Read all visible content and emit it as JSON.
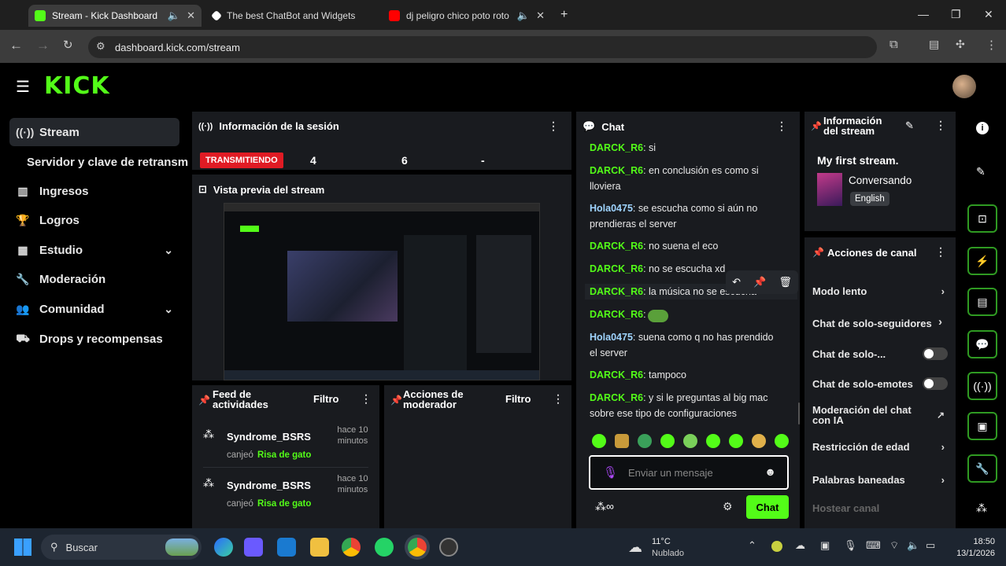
{
  "browser": {
    "tabs": [
      {
        "title": "Stream - Kick Dashboard",
        "active": true
      },
      {
        "title": "The best ChatBot and Widgets"
      },
      {
        "title": "dj peligro chico poto roto -"
      }
    ],
    "url": "dashboard.kick.com/stream"
  },
  "brand": {
    "logo": "KICK",
    "accent": "#53fc18"
  },
  "sidebar": {
    "items": [
      {
        "label": "Stream",
        "icon": "broadcast-icon"
      },
      {
        "label": "Servidor y clave de retransm"
      },
      {
        "label": "Ingresos",
        "icon": "chart-icon"
      },
      {
        "label": "Logros",
        "icon": "trophy-icon"
      },
      {
        "label": "Estudio",
        "icon": "studio-icon"
      },
      {
        "label": "Moderación",
        "icon": "wrench-icon"
      },
      {
        "label": "Comunidad",
        "icon": "users-icon"
      },
      {
        "label": "Drops y recompensas",
        "icon": "gift-icon"
      }
    ]
  },
  "session": {
    "title": "Información de la sesión",
    "status": "TRANSMITIENDO",
    "stats": [
      "4",
      "6",
      "-"
    ]
  },
  "preview": {
    "title": "Vista previa del stream"
  },
  "feed": {
    "title": "Feed de actividades",
    "filter": "Filtro",
    "items": [
      {
        "user": "Syndrome_BSRS",
        "time": "hace 10 minutos",
        "action": "canjeó",
        "reward": "Risa de gato"
      },
      {
        "user": "Syndrome_BSRS",
        "time": "hace 10 minutos",
        "action": "canjeó",
        "reward": "Risa de gato"
      }
    ]
  },
  "modactions": {
    "title": "Acciones de moderador",
    "filter": "Filtro"
  },
  "chat": {
    "title": "Chat",
    "messages": [
      {
        "user": "DARCK_R6",
        "text": "si"
      },
      {
        "user": "DARCK_R6",
        "text": "en conclusión es como si lloviera"
      },
      {
        "user": "Hola0475",
        "text": "se escucha como si aún no prendieras el server"
      },
      {
        "user": "DARCK_R6",
        "text": "no suena el eco"
      },
      {
        "user": "DARCK_R6",
        "text": "no se escucha xd"
      },
      {
        "user": "DARCK_R6",
        "text": "la música no se escucha"
      },
      {
        "user": "DARCK_R6",
        "text": ""
      },
      {
        "user": "Hola0475",
        "text": "suena como q no has prendido el server"
      },
      {
        "user": "DARCK_R6",
        "text": "tampoco"
      },
      {
        "user": "DARCK_R6",
        "text": "y si le preguntas al big mac sobre ese tipo de configuraciones"
      }
    ],
    "placeholder": "Enviar un mensaje",
    "send_label": "Chat"
  },
  "streaminfo": {
    "title": "Información del stream",
    "stream_title": "My first stream.",
    "category": "Conversando",
    "language": "English"
  },
  "channel_actions": {
    "title": "Acciones de canal",
    "rows": [
      {
        "label": "Modo lento",
        "kind": "chevron"
      },
      {
        "label": "Chat de solo-seguidores",
        "kind": "chevron"
      },
      {
        "label": "Chat de solo-...",
        "kind": "toggle"
      },
      {
        "label": "Chat de solo-emotes",
        "kind": "toggle"
      },
      {
        "label": "Moderación del chat con IA",
        "kind": "external"
      },
      {
        "label": "Restricción de edad",
        "kind": "chevron"
      },
      {
        "label": "Palabras baneadas",
        "kind": "chevron"
      },
      {
        "label": "Hostear canal",
        "kind": "disabled"
      }
    ]
  },
  "taskbar": {
    "search": "Buscar",
    "weather_temp": "11°C",
    "weather_desc": "Nublado",
    "time": "18:50",
    "date": "13/1/2026"
  }
}
